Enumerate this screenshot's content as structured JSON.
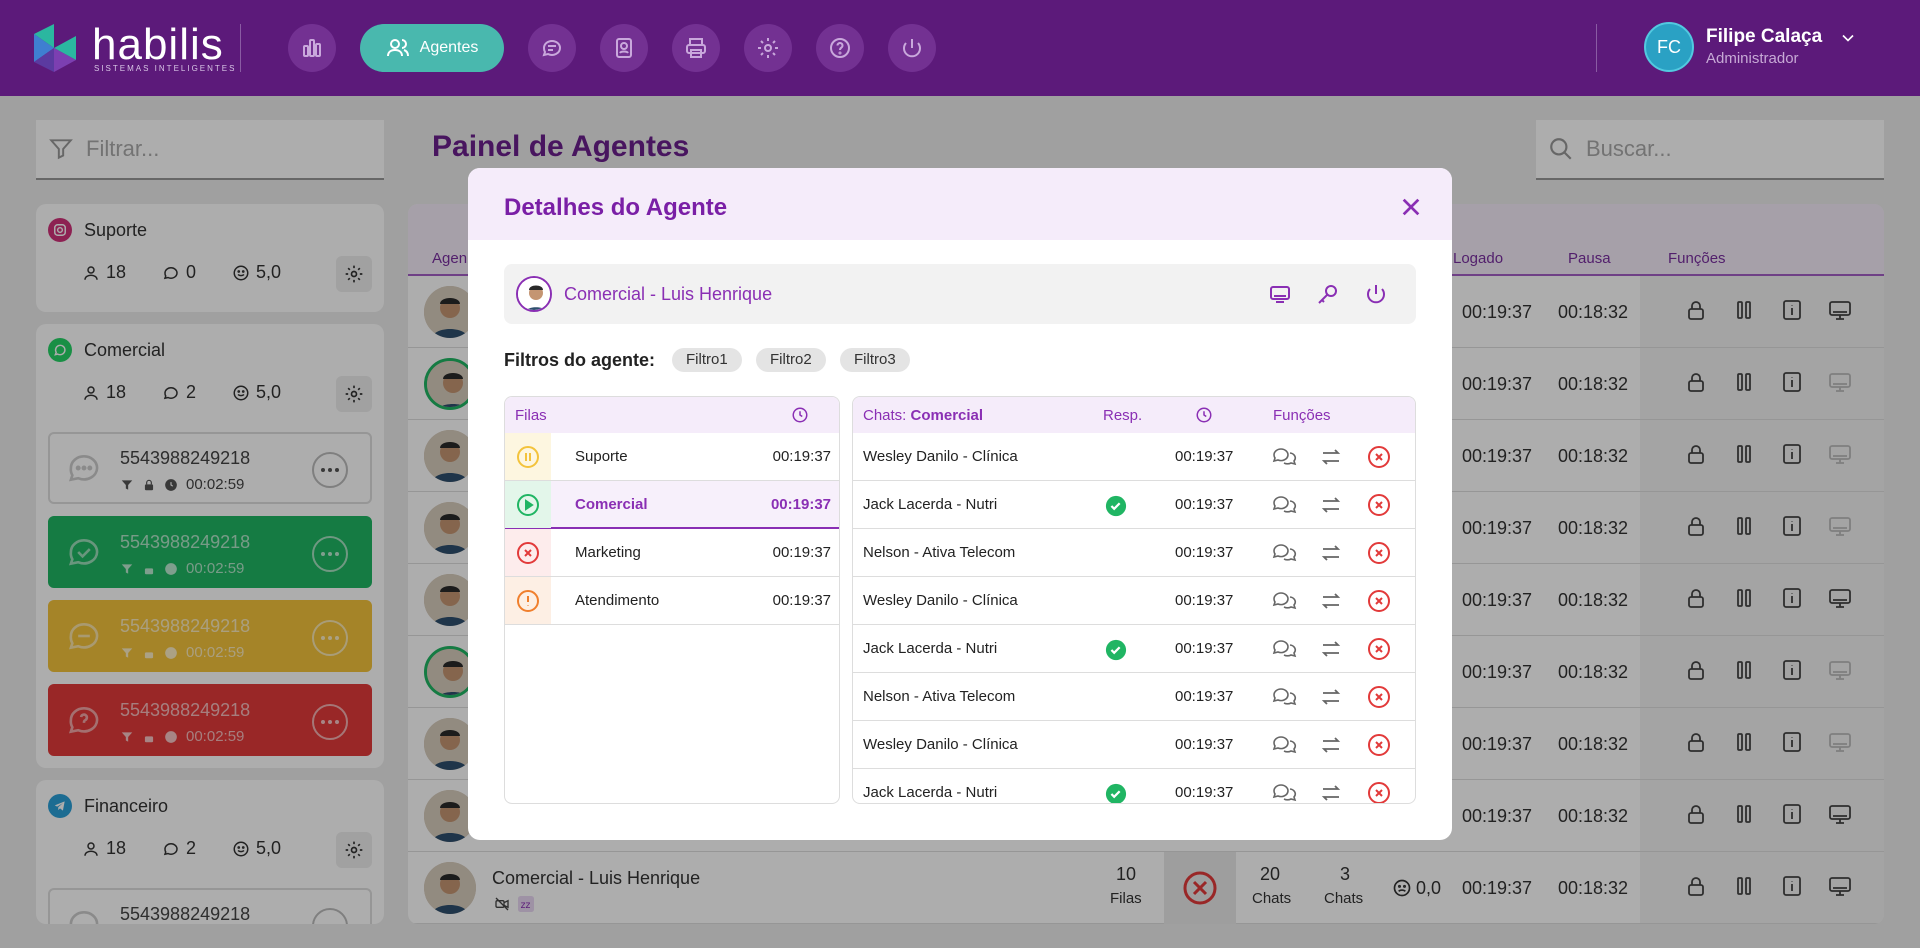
{
  "header": {
    "logo_text": "habilis",
    "logo_sub": "SISTEMAS INTELIGENTES",
    "nav": [
      {
        "id": "dashboard",
        "icon": "bar-chart-icon"
      },
      {
        "id": "agentes",
        "icon": "users-icon",
        "label": "Agentes",
        "active": true
      },
      {
        "id": "chat",
        "icon": "chat-icon"
      },
      {
        "id": "contacts",
        "icon": "contact-book-icon"
      },
      {
        "id": "print",
        "icon": "printer-icon"
      },
      {
        "id": "settings",
        "icon": "gear-icon"
      },
      {
        "id": "help",
        "icon": "help-icon"
      },
      {
        "id": "power",
        "icon": "power-icon"
      }
    ],
    "user": {
      "initials": "FC",
      "name": "Filipe Calaça",
      "role": "Administrador"
    }
  },
  "sidebar": {
    "filter_placeholder": "Filtrar...",
    "queues": [
      {
        "name": "Suporte",
        "channel": "instagram",
        "agents": "18",
        "chats": "0",
        "rating": "5,0"
      },
      {
        "name": "Comercial",
        "channel": "whatsapp",
        "agents": "18",
        "chats": "2",
        "rating": "5,0",
        "cards": [
          {
            "number": "5543988249218",
            "time": "00:02:59",
            "status": "neutral"
          },
          {
            "number": "5543988249218",
            "time": "00:02:59",
            "status": "green"
          },
          {
            "number": "5543988249218",
            "time": "00:02:59",
            "status": "yellow"
          },
          {
            "number": "5543988249218",
            "time": "00:02:59",
            "status": "red"
          }
        ]
      },
      {
        "name": "Financeiro",
        "channel": "telegram",
        "agents": "18",
        "chats": "2",
        "rating": "5,0",
        "cards": [
          {
            "number": "5543988249218",
            "status": "neutral"
          }
        ]
      }
    ]
  },
  "main": {
    "title": "Painel de Agentes",
    "search_placeholder": "Buscar...",
    "columns": {
      "agent": "Agen",
      "logado": "Logado",
      "pausa": "Pausa",
      "funcoes": "Funções"
    },
    "rows": [
      {
        "logado": "00:19:37",
        "pausa": "00:18:32"
      },
      {
        "logado": "00:19:37",
        "pausa": "00:18:32"
      },
      {
        "logado": "00:19:37",
        "pausa": "00:18:32"
      },
      {
        "logado": "00:19:37",
        "pausa": "00:18:32"
      },
      {
        "logado": "00:19:37",
        "pausa": "00:18:32"
      },
      {
        "logado": "00:19:37",
        "pausa": "00:18:32"
      },
      {
        "logado": "00:19:37",
        "pausa": "00:18:32"
      },
      {
        "logado": "00:19:37",
        "pausa": "00:18:32"
      }
    ],
    "last_row": {
      "name": "Comercial - Luis Henrique",
      "filas_count": "10",
      "filas_label": "Filas",
      "chats_count": "20",
      "chats_label": "Chats",
      "chats2_count": "3",
      "chats2_label": "Chats",
      "rating": "0,0",
      "logado": "00:19:37",
      "pausa": "00:18:32"
    }
  },
  "modal": {
    "title": "Detalhes do Agente",
    "agent_name": "Comercial - Luis Henrique",
    "filters_label": "Filtros do agente:",
    "filters": [
      "Filtro1",
      "Filtro2",
      "Filtro3"
    ],
    "queues_header": "Filas",
    "queues": [
      {
        "name": "Suporte",
        "time": "00:19:37",
        "status": "paused"
      },
      {
        "name": "Comercial",
        "time": "00:19:37",
        "status": "active"
      },
      {
        "name": "Marketing",
        "time": "00:19:37",
        "status": "closed"
      },
      {
        "name": "Atendimento",
        "time": "00:19:37",
        "status": "alert"
      }
    ],
    "chats_header_prefix": "Chats:",
    "chats_header_queue": "Comercial",
    "resp_header": "Resp.",
    "funcoes_header": "Funções",
    "chats": [
      {
        "name": "Wesley Danilo - Clínica",
        "resp": false,
        "time": "00:19:37"
      },
      {
        "name": "Jack Lacerda - Nutri",
        "resp": true,
        "time": "00:19:37"
      },
      {
        "name": "Nelson - Ativa Telecom",
        "resp": false,
        "time": "00:19:37"
      },
      {
        "name": "Wesley Danilo - Clínica",
        "resp": false,
        "time": "00:19:37"
      },
      {
        "name": "Jack Lacerda - Nutri",
        "resp": true,
        "time": "00:19:37"
      },
      {
        "name": "Nelson - Ativa Telecom",
        "resp": false,
        "time": "00:19:37"
      },
      {
        "name": "Wesley Danilo - Clínica",
        "resp": false,
        "time": "00:19:37"
      },
      {
        "name": "Jack Lacerda - Nutri",
        "resp": true,
        "time": "00:19:37"
      }
    ]
  },
  "colors": {
    "header": "#5c1a7a",
    "accent": "#8a2fb4",
    "teal": "#49b8ae",
    "green": "#20b563",
    "yellow": "#f3c33c",
    "red": "#e23a3a"
  }
}
